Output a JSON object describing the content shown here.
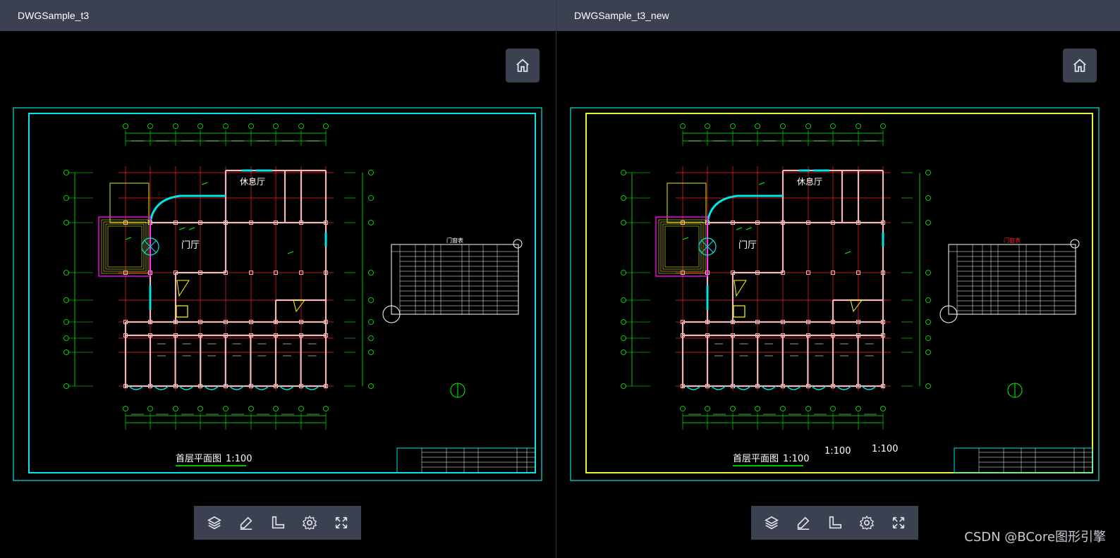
{
  "left": {
    "title": "DWGSample_t3",
    "drawing": {
      "room_labels": [
        "休息厅",
        "门厅"
      ],
      "table_title": "门窗表",
      "plan_title": "首层平面图",
      "plan_scale": "1:100"
    }
  },
  "right": {
    "title": "DWGSample_t3_new",
    "drawing": {
      "room_labels": [
        "休息厅",
        "门厅"
      ],
      "table_title": "门窗表",
      "plan_title": "首层平面图",
      "plan_scale": "1:100",
      "extra_scales": [
        "1:100",
        "1:100"
      ]
    }
  },
  "toolbar": {
    "tools": [
      "layers-icon",
      "pen-icon",
      "ruler-icon",
      "settings-icon",
      "fullscreen-icon"
    ]
  },
  "home_icon": "home-icon",
  "colors": {
    "titlebar": "#3b4150",
    "cyan": "#00e5e5",
    "green": "#00ff00",
    "red": "#ff2020",
    "yellow_frame": "#e6f23a",
    "magenta": "#ff00ff"
  },
  "watermark": "CSDN @BCore图形引擎"
}
